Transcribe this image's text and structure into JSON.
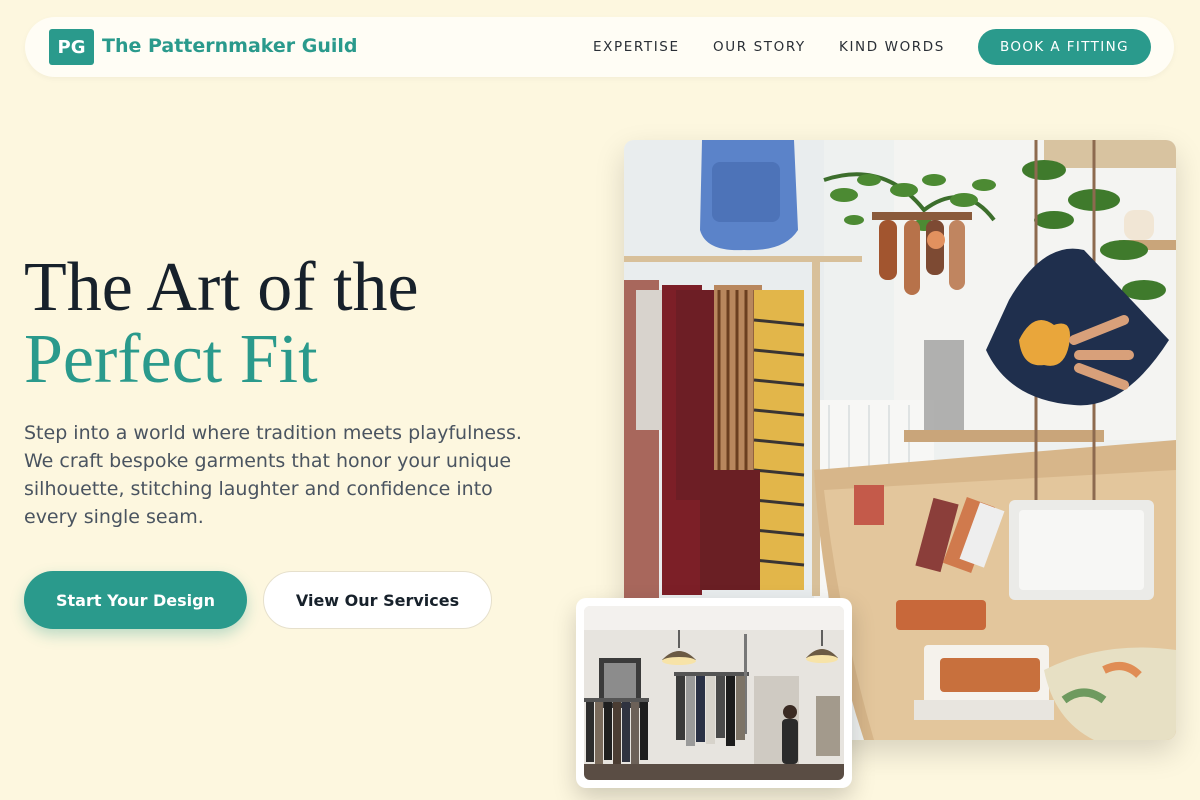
{
  "brand": {
    "badge": "PG",
    "name": "The Patternmaker Guild"
  },
  "nav": {
    "links": [
      "EXPERTISE",
      "OUR STORY",
      "KIND WORDS"
    ],
    "cta": "BOOK A FITTING"
  },
  "hero": {
    "title_line1": "The Art of the",
    "title_line2": "Perfect Fit",
    "lead": "Step into a world where tradition meets playfulness. We craft bespoke garments that honor your unique silhouette, stitching laughter and confidence into every single seam.",
    "primary_button": "Start Your Design",
    "secondary_button": "View Our Services"
  },
  "colors": {
    "accent": "#2a9a8c",
    "background": "#fdf7df",
    "heading": "#17212b"
  }
}
